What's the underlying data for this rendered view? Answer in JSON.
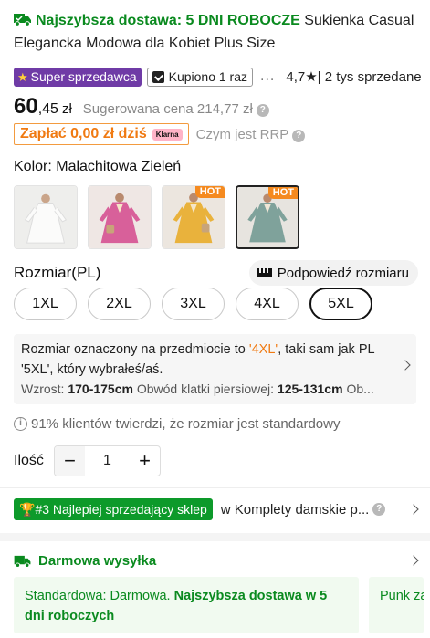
{
  "product": {
    "delivery_prefix": "Najszybsza dostawa: 5 DNI ROBOCZE",
    "name": "Sukienka Casual Elegancka Modowa dla Kobiet Plus Size"
  },
  "badges": {
    "super_seller": "Super sprzedawca",
    "bought": "Kupiono 1 raz",
    "more": "...",
    "rating": "4,7",
    "sold": "| 2 tys sprzedane"
  },
  "price": {
    "main": "60",
    "cents": ",45",
    "currency": "zł",
    "rrp_label": "Sugerowana cena",
    "rrp_value": "214,77 zł",
    "help": "?"
  },
  "pay": {
    "text": "Zapłać 0,00 zł dziś",
    "klarna": "Klarna",
    "rrp_link": "Czym jest RRP"
  },
  "color": {
    "label": "Kolor: Malachitowa Zieleń",
    "swatches": [
      {
        "name": "white",
        "color": "#f4f4f2",
        "hot": ""
      },
      {
        "name": "pink",
        "color": "#d8609a",
        "hot": ""
      },
      {
        "name": "yellow",
        "color": "#e9b23c",
        "hot": "HOT"
      },
      {
        "name": "green",
        "color": "#7fa29b",
        "hot": "HOT"
      }
    ]
  },
  "size": {
    "label": "Rozmiar(PL)",
    "hint": "Podpowiedź rozmiaru",
    "options": [
      "1XL",
      "2XL",
      "3XL",
      "4XL",
      "5XL"
    ],
    "selected": "5XL"
  },
  "info": {
    "line_before": "Rozmiar oznaczony na przedmiocie to ",
    "marked": "'4XL'",
    "line_after": ", taki sam jak PL '5XL', który wybrałeś/aś.",
    "height_label": "Wzrost:",
    "height_value": "170-175cm",
    "chest_label": "Obwód klatki piersiowej:",
    "chest_value": "125-131cm",
    "more": "Ob..."
  },
  "stat": {
    "icon": "i",
    "text": "91% klientów twierdzi, że rozmiar jest standardowy"
  },
  "quantity": {
    "label": "Ilość",
    "value": "1",
    "minus": "−",
    "plus": "+"
  },
  "shop": {
    "badge": "#3 Najlepiej sprzedający sklep",
    "category": "w Komplety damskie p..."
  },
  "shipping": {
    "title": "Darmowa wysyłka",
    "card_prefix": "Standardowa: Darmowa. ",
    "card_bold": "Najszybsza dostawa w 5 dni roboczych",
    "card2": "Punk zamó"
  }
}
